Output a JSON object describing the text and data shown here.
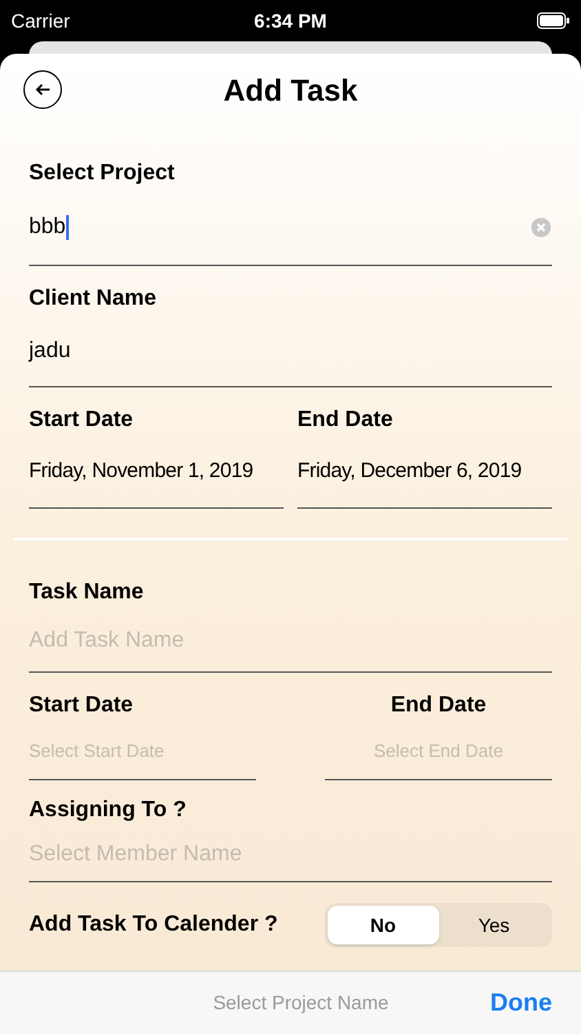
{
  "status_bar": {
    "carrier": "Carrier",
    "time": "6:34 PM"
  },
  "header": {
    "title": "Add Task"
  },
  "project": {
    "label": "Select Project",
    "value": "bbb"
  },
  "client": {
    "label": "Client Name",
    "value": "jadu"
  },
  "project_dates": [
    {
      "label": "Start Date",
      "value": "Friday, November 1, 2019"
    },
    {
      "label": "End Date",
      "value": "Friday, December 6, 2019"
    }
  ],
  "task_name": {
    "label": "Task Name",
    "placeholder": "Add Task Name"
  },
  "task_dates": [
    {
      "label": "Start Date",
      "placeholder": "Select Start Date"
    },
    {
      "label": "End Date",
      "placeholder": "Select End Date"
    }
  ],
  "assign": {
    "label": "Assigning To ?",
    "placeholder": "Select Member Name"
  },
  "calendar": {
    "label": "Add Task To Calender ?",
    "options": [
      {
        "label": "No",
        "selected": true
      },
      {
        "label": "Yes",
        "selected": false
      }
    ]
  },
  "toolbar": {
    "title": "Select Project Name",
    "done": "Done"
  }
}
